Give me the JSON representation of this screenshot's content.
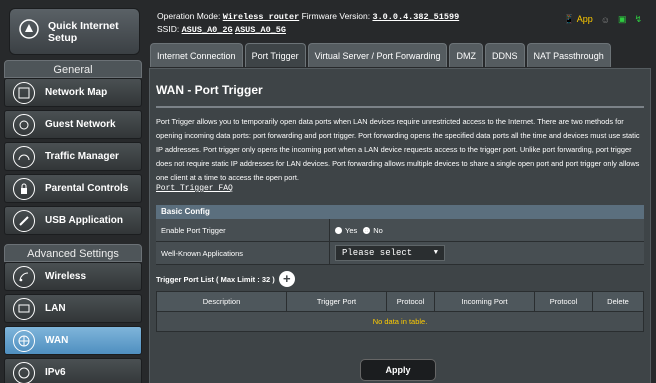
{
  "sidebar": {
    "quick_setup": "Quick Internet Setup",
    "general_header": "General",
    "general_items": [
      {
        "label": "Network Map",
        "icon": "network-map-icon"
      },
      {
        "label": "Guest Network",
        "icon": "guest-network-icon"
      },
      {
        "label": "Traffic Manager",
        "icon": "traffic-manager-icon"
      },
      {
        "label": "Parental Controls",
        "icon": "parental-controls-icon"
      },
      {
        "label": "USB Application",
        "icon": "usb-application-icon"
      }
    ],
    "advanced_header": "Advanced Settings",
    "advanced_items": [
      {
        "label": "Wireless",
        "icon": "wireless-icon"
      },
      {
        "label": "LAN",
        "icon": "lan-icon"
      },
      {
        "label": "WAN",
        "icon": "wan-icon"
      },
      {
        "label": "IPv6",
        "icon": "ipv6-icon"
      }
    ]
  },
  "topbar": {
    "op_mode_label": "Operation Mode:",
    "op_mode_value": "Wireless router",
    "fw_label": "Firmware Version:",
    "fw_value": "3.0.0.4.382_51599",
    "ssid_label": "SSID:",
    "ssid_1": "ASUS_A0_2G",
    "ssid_2": "ASUS_A0_5G",
    "app_label": "App"
  },
  "tabs": [
    "Internet Connection",
    "Port Trigger",
    "Virtual Server / Port Forwarding",
    "DMZ",
    "DDNS",
    "NAT Passthrough"
  ],
  "page": {
    "title": "WAN - Port Trigger",
    "description": "Port Trigger allows you to temporarily open data ports when LAN devices require unrestricted access to the Internet. There are two methods for opening incoming data ports: port forwarding and port trigger. Port forwarding opens the specified data ports all the time and devices must use static IP addresses. Port trigger only opens the incoming port when a LAN device requests access to the trigger port. Unlike port forwarding, port trigger does not require static IP addresses for LAN devices. Port forwarding allows multiple devices to share a single open port and port trigger only allows one client at a time to access the open port.",
    "faq_link": "Port Trigger FAQ",
    "basic_config": "Basic Config",
    "enable_label": "Enable Port Trigger",
    "yes": "Yes",
    "no": "No",
    "well_known_label": "Well-Known Applications",
    "select_value": "Please select",
    "list_title": "Trigger Port List ( Max Limit : 32 )",
    "columns": [
      "Description",
      "Trigger Port",
      "Protocol",
      "Incoming Port",
      "Protocol",
      "Delete"
    ],
    "empty_text": "No data in table.",
    "apply": "Apply"
  }
}
